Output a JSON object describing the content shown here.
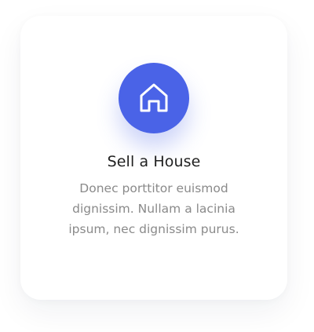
{
  "card": {
    "title": "Sell a House",
    "description": "Donec porttitor euismod dignissim. Nullam a lacinia ipsum, nec dignissim purus.",
    "icon": "home-icon"
  },
  "colors": {
    "accent": "#4a63e7",
    "title": "#1f1f1f",
    "description": "#8a8a8a",
    "background": "#ffffff"
  }
}
